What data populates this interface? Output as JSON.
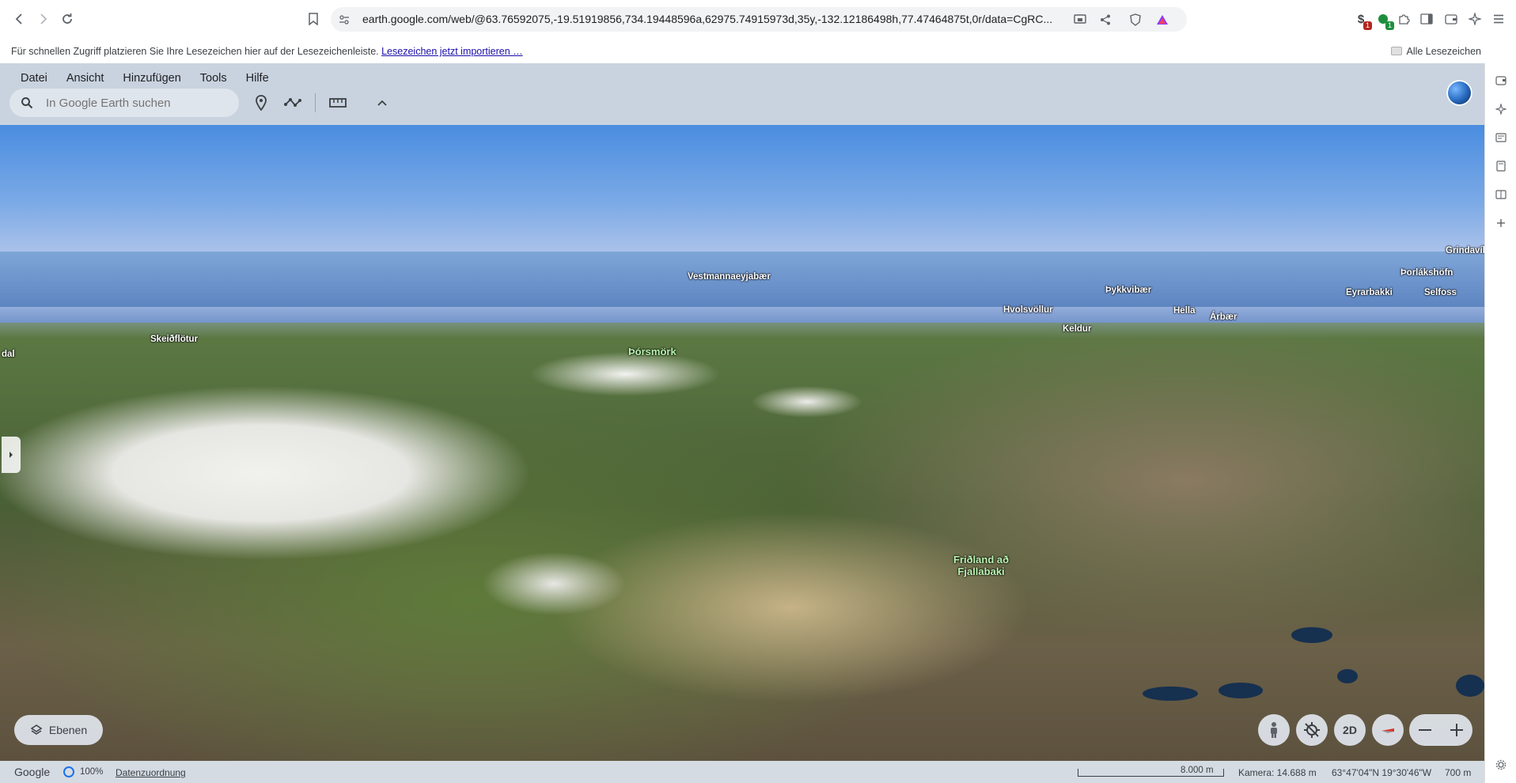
{
  "browser": {
    "url": "earth.google.com/web/@63.76592075,-19.51919856,734.19448596a,62975.74915973d,35y,-132.12186498h,77.47464875t,0r/data=CgRC...",
    "extensions": [
      {
        "icon": "extension-dollar-icon",
        "badge": "1",
        "badge_color": "#b3261e"
      },
      {
        "icon": "extension-green-icon",
        "badge": "1",
        "badge_color": "#1e8e3e"
      }
    ]
  },
  "bookmarks_bar": {
    "hint": "Für schnellen Zugriff platzieren Sie Ihre Lesezeichen hier auf der Lesezeichenleiste.",
    "import_link": "Lesezeichen jetzt importieren …",
    "all_bookmarks": "Alle Lesezeichen"
  },
  "earth": {
    "menu": [
      "Datei",
      "Ansicht",
      "Hinzufügen",
      "Tools",
      "Hilfe"
    ],
    "search_placeholder": "In Google Earth suchen",
    "places": [
      {
        "name": "Vestmannaeyjabær"
      },
      {
        "name": "Þykkvibær"
      },
      {
        "name": "Grindavík"
      },
      {
        "name": "Þorlákshöfn"
      },
      {
        "name": "Eyrarbakki"
      },
      {
        "name": "Selfoss"
      },
      {
        "name": "Hvolsvöllur"
      },
      {
        "name": "Hella"
      },
      {
        "name": "Árbær"
      },
      {
        "name": "Keldur"
      },
      {
        "name": "Skeiðflötur"
      },
      {
        "name": "dal"
      },
      {
        "name": "Þórsmörk"
      },
      {
        "name": "Friðland að\nFjallabaki"
      }
    ],
    "layers_label": "Ebenen",
    "view_2d_label": "2D",
    "status": {
      "brand": "Google",
      "load_percent": "100%",
      "attribution_link": "Datenzuordnung",
      "scale": "8.000 m",
      "camera": "Kamera: 14.688 m",
      "coords": "63°47'04\"N 19°30'46\"W",
      "elevation": "700 m"
    }
  }
}
